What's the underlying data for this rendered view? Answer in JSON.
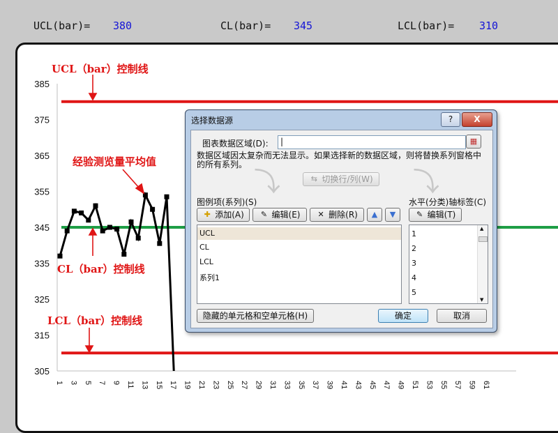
{
  "stats": [
    {
      "label": "UCL(bar)=",
      "value": "380"
    },
    {
      "label": "CL(bar)=",
      "value": "345"
    },
    {
      "label": "LCL(bar)=",
      "value": "310"
    }
  ],
  "annotations": {
    "ucl": "UCL（bar）控制线",
    "avg": "经验测览量平均值",
    "cl": "CL（bar）控制线",
    "lcl": "LCL（bar）控制线"
  },
  "colors": {
    "ucl": "#e01515",
    "cl": "#1e9e45",
    "lcl": "#e01515",
    "series": "#000000"
  },
  "chart_data": {
    "type": "line",
    "y_ticks": [
      385,
      375,
      365,
      355,
      345,
      335,
      325,
      315,
      305
    ],
    "ylim": [
      305,
      385
    ],
    "x_ticks": [
      "1",
      "3",
      "5",
      "7",
      "9",
      "11",
      "13",
      "15",
      "17",
      "19",
      "21",
      "23",
      "25",
      "27",
      "29",
      "31",
      "33",
      "35",
      "37",
      "39",
      "41",
      "43",
      "45",
      "47",
      "49",
      "51",
      "53",
      "55",
      "57",
      "59",
      "61"
    ],
    "x_range": [
      1,
      64
    ],
    "series": [
      {
        "name": "系列1",
        "x": [
          1,
          2,
          3,
          4,
          5,
          6,
          7,
          8,
          9,
          10,
          11,
          12,
          13,
          14,
          15,
          16,
          17
        ],
        "values": [
          337,
          344,
          349.5,
          349,
          347,
          351,
          344,
          345,
          344.5,
          337.5,
          346.5,
          342,
          354,
          350,
          340.5,
          353.5,
          305
        ],
        "color": "#000000"
      },
      {
        "name": "UCL",
        "value": 380,
        "color": "#e01515"
      },
      {
        "name": "CL",
        "value": 345,
        "color": "#1e9e45"
      },
      {
        "name": "LCL",
        "value": 310,
        "color": "#e01515"
      }
    ]
  },
  "dialog": {
    "title": "选择数据源",
    "help": "?",
    "close": "X",
    "range_label": "图表数据区域(D):",
    "range_value": "|",
    "message": "数据区域因太复杂而无法显示。如果选择新的数据区域，则将替换系列窗格中的所有系列。",
    "switch_btn": "切换行/列(W)",
    "legend_label": "图例项(系列)(S)",
    "add_btn": "添加(A)",
    "edit_btn": "编辑(E)",
    "remove_btn": "删除(R)",
    "axis_label": "水平(分类)轴标签(C)",
    "axis_edit_btn": "编辑(T)",
    "series_items": [
      "UCL",
      "CL",
      "LCL",
      "系列1"
    ],
    "axis_items": [
      "1",
      "2",
      "3",
      "4",
      "5"
    ],
    "hidden_btn": "隐藏的单元格和空单元格(H)",
    "ok_btn": "确定",
    "cancel_btn": "取消"
  }
}
